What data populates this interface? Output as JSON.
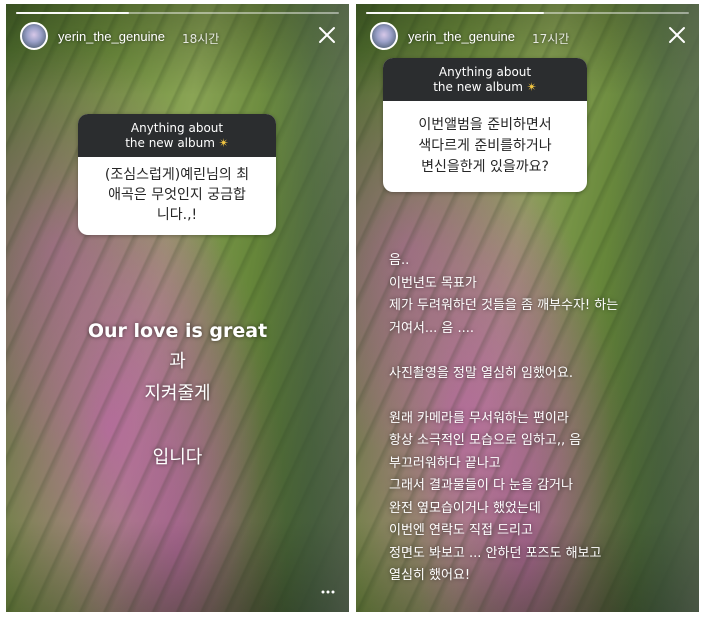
{
  "stories": [
    {
      "username": "yerin_the_genuine",
      "time": "18시간",
      "progress": 0.35,
      "question_header_line1": "Anything about",
      "question_header_line2": "the new album",
      "question_body": [
        "(조심스럽게)예린님의 최",
        "애곡은 무엇인지 궁금합",
        "니다.,!"
      ],
      "answer": [
        "Our love is great",
        "과",
        "지켜줄게",
        "",
        "입니다"
      ]
    },
    {
      "username": "yerin_the_genuine",
      "time": "17시간",
      "progress": 0.55,
      "question_header_line1": "Anything about",
      "question_header_line2": "the new album",
      "question_body": [
        "이번앨범을 준비하면서",
        "색다르게 준비를하거나",
        "변신을한게 있을까요?"
      ],
      "answer": [
        "음..",
        "이번년도 목표가",
        "제가 두려워하던 것들을 좀 깨부수자! 하는",
        "거여서... 음 ....",
        "",
        "사진촬영을 정말 열심히 임했어요.",
        "",
        "원래 카메라를 무서워하는 편이라",
        "항상 소극적인 모습으로 임하고,, 음",
        "부끄러워하다 끝나고",
        "그래서 결과물들이 다 눈을 감거나",
        "완전 옆모습이거나 했었는데",
        "이번엔 연락도 직접 드리고",
        "정면도 봐보고 ... 안하던 포즈도 해보고",
        "열심히 했어요!"
      ]
    }
  ],
  "icons": {
    "close": "close-icon",
    "star": "sparkle-star-icon",
    "more": "more-options-icon"
  },
  "colors": {
    "card_header": "#2b2d2f",
    "card_body": "#ffffff",
    "star": "#f5c842"
  }
}
